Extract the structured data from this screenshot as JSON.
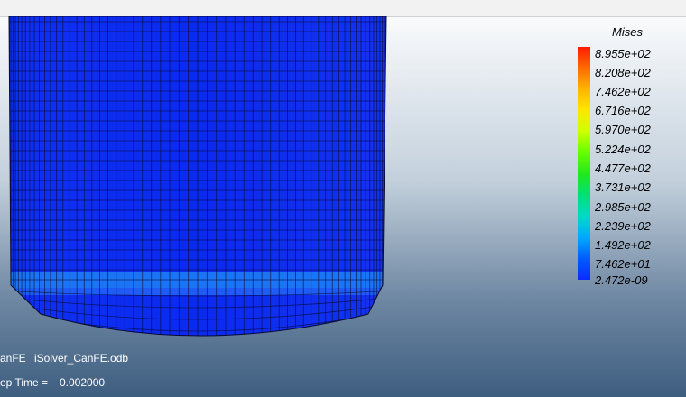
{
  "legend": {
    "title": "Mises",
    "labels": [
      "8.955e+02",
      "8.208e+02",
      "7.462e+02",
      "6.716e+02",
      "5.970e+02",
      "5.224e+02",
      "4.477e+02",
      "3.731e+02",
      "2.985e+02",
      "2.239e+02",
      "1.492e+02",
      "7.462e+01",
      "2.472e-09"
    ]
  },
  "info": {
    "model": "anFE",
    "odb": "iSolver_CanFE.odb",
    "step_time_label": "ep Time =",
    "step_time_value": "0.002000"
  },
  "colors": {
    "mesh_body": "#0f2cf0",
    "mesh_band": "#1b74f5",
    "mesh_band_light": "#3c9bff",
    "mesh_lines": "#0a0a30"
  }
}
